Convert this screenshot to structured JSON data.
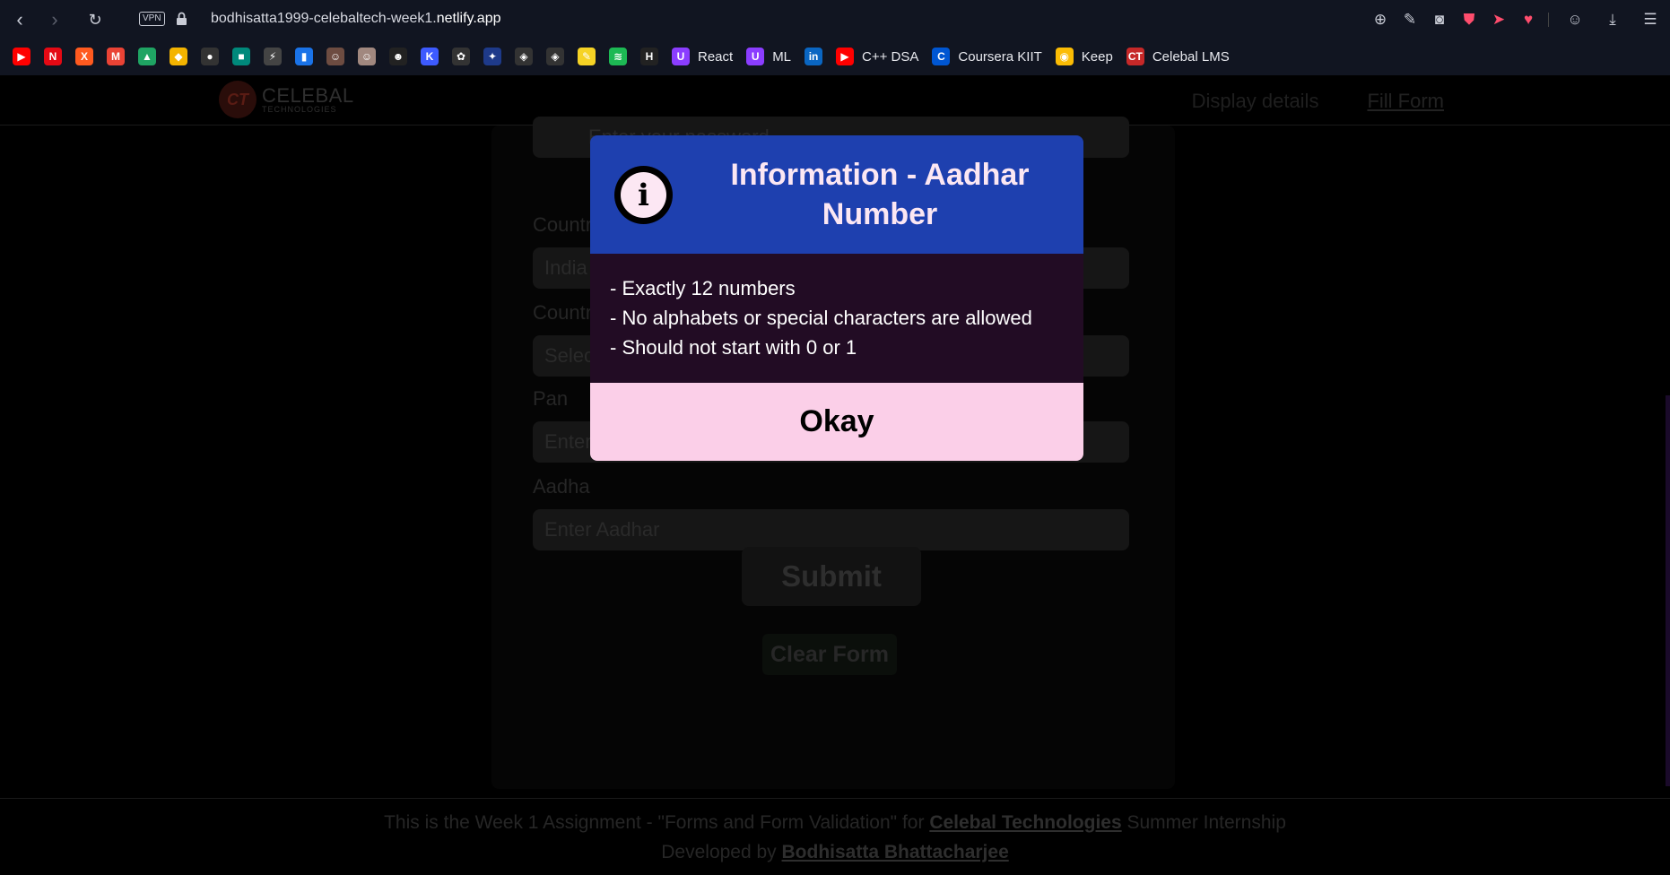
{
  "browser": {
    "vpn_label": "VPN",
    "url_prefix": "bodhisatta1999-celebaltech-week1.",
    "url_domain": "netlify.app",
    "bookmarks": [
      {
        "icon": "youtube-icon",
        "color": "#ff0000",
        "glyph": "▶"
      },
      {
        "icon": "netflix-icon",
        "color": "#e50914",
        "glyph": "N"
      },
      {
        "icon": "x-icon",
        "color": "#ff5a1f",
        "glyph": "X"
      },
      {
        "icon": "gmail-icon",
        "color": "#ea4335",
        "glyph": "M"
      },
      {
        "icon": "drive-icon",
        "color": "#1fa463",
        "glyph": "▲"
      },
      {
        "icon": "photos-icon",
        "color": "#f4b400",
        "glyph": "◆"
      },
      {
        "icon": "github-icon",
        "color": "#333",
        "glyph": "●"
      },
      {
        "icon": "meet-icon",
        "color": "#00897b",
        "glyph": "■"
      },
      {
        "icon": "feather-icon",
        "color": "#444",
        "glyph": "⚡"
      },
      {
        "icon": "analytics-icon",
        "color": "#1a73e8",
        "glyph": "▮"
      },
      {
        "icon": "profile-1-icon",
        "color": "#6d4c41",
        "glyph": "☺"
      },
      {
        "icon": "profile-2-icon",
        "color": "#a1887f",
        "glyph": "☺"
      },
      {
        "icon": "smiley-icon",
        "color": "#222",
        "glyph": "☻"
      },
      {
        "icon": "kotlin-icon",
        "color": "#3d5afe",
        "glyph": "K"
      },
      {
        "icon": "chatgpt-icon",
        "color": "#333",
        "glyph": "✿"
      },
      {
        "icon": "gemini-icon",
        "color": "#1e3a8a",
        "glyph": "✦"
      },
      {
        "icon": "unity-icon",
        "color": "#333",
        "glyph": "◈"
      },
      {
        "icon": "unity-2-icon",
        "color": "#333",
        "glyph": "◈"
      },
      {
        "icon": "sticky-icon",
        "color": "#f6d325",
        "glyph": "✎"
      },
      {
        "icon": "spotify-icon",
        "color": "#1db954",
        "glyph": "≋"
      },
      {
        "icon": "hashnode-icon",
        "color": "#222",
        "glyph": "H"
      },
      {
        "icon": "react-bookmark-icon",
        "color": "#8b3dff",
        "glyph": "U",
        "label": "React"
      },
      {
        "icon": "ml-bookmark-icon",
        "color": "#8b3dff",
        "glyph": "U",
        "label": "ML"
      },
      {
        "icon": "linkedin-icon",
        "color": "#0a66c2",
        "glyph": "in"
      },
      {
        "icon": "youtube-dsa-icon",
        "color": "#ff0000",
        "glyph": "▶",
        "label": "C++ DSA"
      },
      {
        "icon": "coursera-icon",
        "color": "#0056d2",
        "glyph": "C",
        "label": "Coursera KIIT"
      },
      {
        "icon": "keep-icon",
        "color": "#fbbc04",
        "glyph": "◉",
        "label": "Keep"
      },
      {
        "icon": "celebal-icon",
        "color": "#c62828",
        "glyph": "CT",
        "label": "Celebal LMS"
      }
    ]
  },
  "site": {
    "logo_initials": "CT",
    "logo_name": "Celebal",
    "logo_tagline": "Technologies",
    "nav": [
      "Display details",
      "Fill Form"
    ],
    "form": {
      "password_placeholder": "Enter your password",
      "country_label": "Countr",
      "country_value": "India",
      "country2_label": "Countr",
      "country2_value": "Selec",
      "pan_label": "Pan",
      "pan_placeholder": "Enter",
      "aadhar_label": "Aadha",
      "aadhar_placeholder": "Enter Aadhar",
      "submit_label": "Submit",
      "clear_label": "Clear Form"
    },
    "footer": {
      "line1_prefix": "This is the Week 1 Assignment - \"Forms and Form Validation\" for ",
      "line1_link": "Celebal Technologies",
      "line1_suffix": " Summer Internship",
      "line2_prefix": "Developed by ",
      "line2_link": "Bodhisatta Bhattacharjee"
    }
  },
  "modal": {
    "icon_glyph": "i",
    "title": "Information - Aadhar Number",
    "rules": [
      "- Exactly 12 numbers",
      "- No alphabets or special characters are allowed",
      "- Should not start with 0 or 1"
    ],
    "okay_label": "Okay"
  }
}
